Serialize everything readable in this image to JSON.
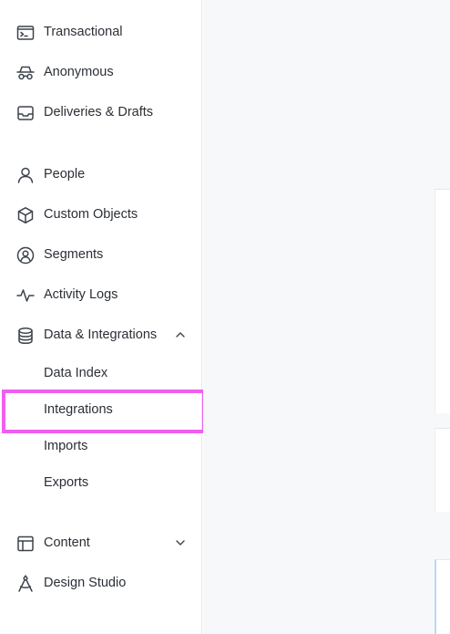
{
  "sidebar": {
    "items": [
      {
        "label": "Transactional",
        "icon": "terminal-window-icon"
      },
      {
        "label": "Anonymous",
        "icon": "incognito-icon"
      },
      {
        "label": "Deliveries & Drafts",
        "icon": "inbox-tray-icon"
      },
      {
        "label": "People",
        "icon": "person-icon"
      },
      {
        "label": "Custom Objects",
        "icon": "cube-icon"
      },
      {
        "label": "Segments",
        "icon": "user-circle-icon"
      },
      {
        "label": "Activity Logs",
        "icon": "pulse-icon"
      },
      {
        "label": "Data & Integrations",
        "icon": "database-icon",
        "expanded": true
      },
      {
        "label": "Content",
        "icon": "layout-icon",
        "expanded": false
      },
      {
        "label": "Design Studio",
        "icon": "compass-icon"
      }
    ],
    "data_integrations_subitems": [
      {
        "label": "Data Index"
      },
      {
        "label": "Integrations",
        "highlighted": true
      },
      {
        "label": "Imports"
      },
      {
        "label": "Exports"
      }
    ]
  },
  "colors": {
    "highlight_border": "#f05ef0",
    "sidebar_border": "#e6e8eb",
    "main_background": "#f7f8f9",
    "text": "#2b2f36",
    "icon": "#3d434c"
  }
}
